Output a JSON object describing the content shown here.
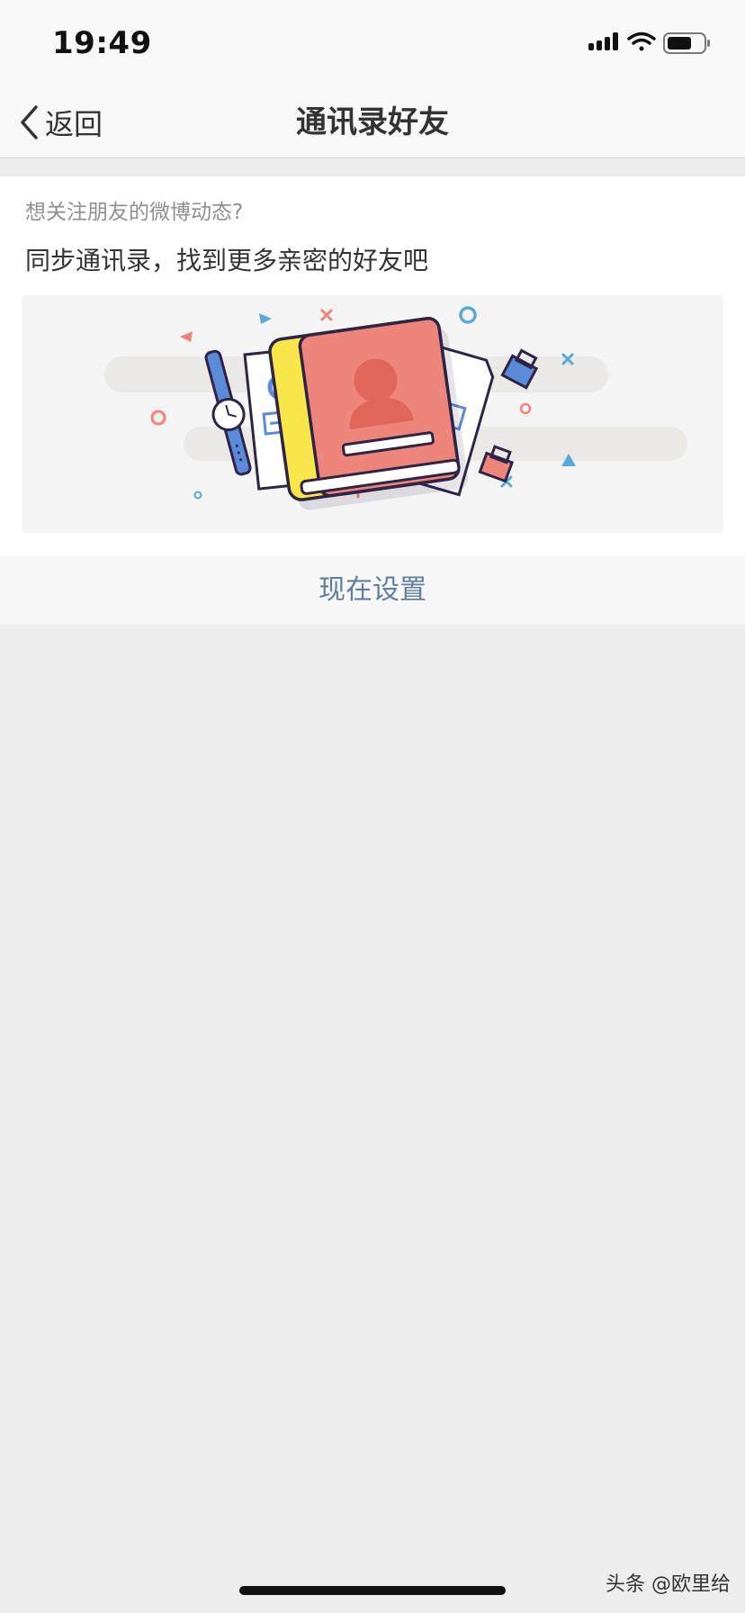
{
  "status_bar": {
    "time": "19:49",
    "icons": [
      "signal-icon",
      "wifi-icon",
      "battery-icon"
    ]
  },
  "nav": {
    "back_label": "返回",
    "title": "通讯录好友"
  },
  "card": {
    "subtitle": "想关注朋友的微博动态?",
    "headline": "同步通讯录，找到更多亲密的好友吧",
    "illustration": "address-book-illustration"
  },
  "action": {
    "label": "现在设置"
  },
  "watermark": "头条 @欧里给",
  "colors": {
    "background": "#ededed",
    "bar": "#f8f8f8",
    "link": "#5f7ea1",
    "book_cover": "#ee857a",
    "book_spine": "#f8e64a"
  }
}
